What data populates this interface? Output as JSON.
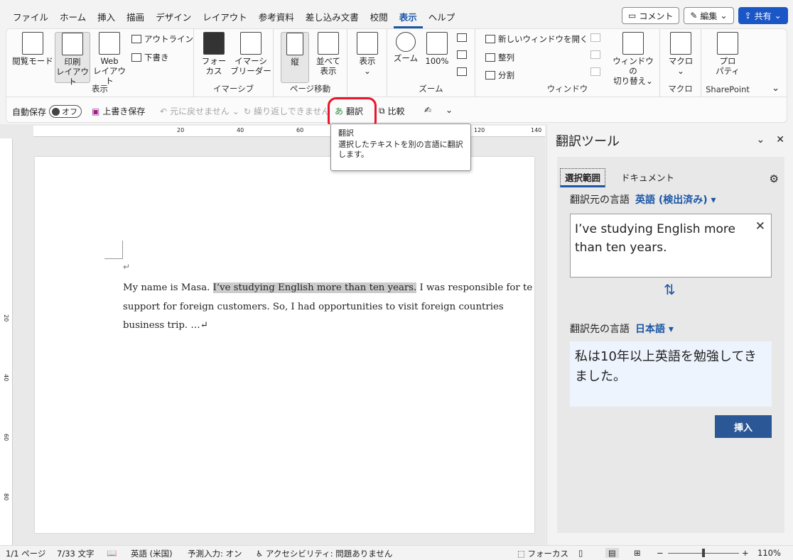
{
  "menu": {
    "tabs": [
      "ファイル",
      "ホーム",
      "挿入",
      "描画",
      "デザイン",
      "レイアウト",
      "参考資料",
      "差し込み文書",
      "校閲",
      "表示",
      "ヘルプ"
    ],
    "active_tab": "表示",
    "comment_label": "コメント",
    "edit_label": "編集",
    "share_label": "共有"
  },
  "ribbon": {
    "view_group": {
      "label": "表示",
      "read_mode": "閲覧モード",
      "print_layout_1": "印刷",
      "print_layout_2": "レイアウト",
      "web_layout_1": "Web",
      "web_layout_2": "レイアウト",
      "outline": "アウトライン",
      "draft": "下書き"
    },
    "immersive_group": {
      "label": "イマーシブ",
      "focus_1": "フォー",
      "focus_2": "カス",
      "reader_1": "イマーシ",
      "reader_2": "ブリーダー"
    },
    "page_move_group": {
      "label": "ページ移動",
      "vertical": "縦",
      "side_1": "並べて",
      "side_2": "表示"
    },
    "show_group": {
      "label": "表示"
    },
    "zoom_group": {
      "label": "ズーム",
      "zoom": "ズーム",
      "zoom_100": "100%"
    },
    "window_group": {
      "label": "ウィンドウ",
      "new_window": "新しいウィンドウを開く",
      "arrange": "整列",
      "split": "分割",
      "switch_1": "ウィンドウの",
      "switch_2": "切り替え"
    },
    "macro_group": {
      "label": "マクロ",
      "macro": "マクロ"
    },
    "sharepoint_group": {
      "label": "SharePoint",
      "prop_1": "プロ",
      "prop_2": "パティ"
    }
  },
  "qat": {
    "autosave": "自動保存",
    "toggle": "オフ",
    "save": "上書き保存",
    "undo": "元に戻せません",
    "redo": "繰り返しできません",
    "translate": "翻訳",
    "compare": "比較"
  },
  "tooltip": {
    "title": "翻訳",
    "line1": "選択したテキストを別の言語に翻訳",
    "line2": "します。"
  },
  "ruler": [
    "20",
    "40",
    "60",
    "120",
    "140"
  ],
  "vruler": [
    "20",
    "40",
    "60",
    "80"
  ],
  "document": {
    "line1_before": "My name is Masa. ",
    "line1_selected": "I’ve studying English more than ten years.",
    "line1_after": " I was responsible for te",
    "line2": "support for foreign customers. So, I had opportunities to visit foreign countries",
    "line3": "business trip. …↵",
    "para_mark": "↵"
  },
  "pane": {
    "title": "翻訳ツール",
    "tab_selection": "選択範囲",
    "tab_document": "ドキュメント",
    "source_label": "翻訳元の言語",
    "source_lang": "英語 (検出済み)",
    "source_text": "I’ve studying English more than ten years.",
    "target_label": "翻訳先の言語",
    "target_lang": "日本語",
    "target_text": "私は10年以上英語を勉強してきました。",
    "insert": "挿入"
  },
  "status": {
    "page": "1/1 ページ",
    "words": "7/33 文字",
    "lang": "英語 (米国)",
    "predict": "予測入力: オン",
    "access": "アクセシビリティ: 問題ありません",
    "focus": "フォーカス",
    "zoom": "110%"
  },
  "colors": {
    "accent": "#1a56a6",
    "highlight": "#e8152a",
    "insert_button": "#2b5797"
  }
}
